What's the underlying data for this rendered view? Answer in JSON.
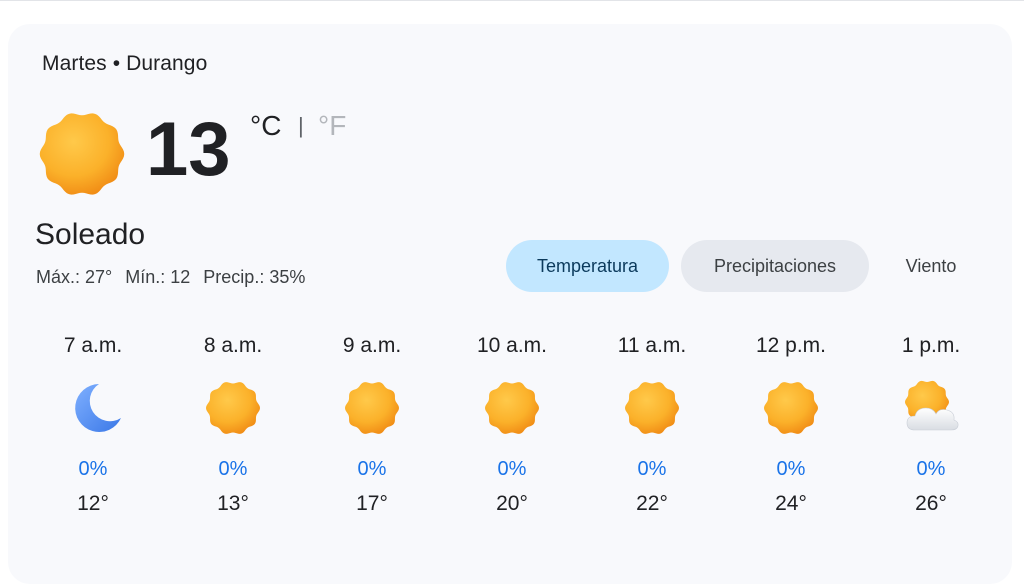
{
  "header": {
    "subtitle": "Martes • Durango"
  },
  "current": {
    "temperature": "13",
    "unit_c": "°C",
    "unit_separator": "|",
    "unit_f": "°F",
    "condition": "Soleado",
    "icon": "sun-icon",
    "max": "Máx.: 27°",
    "min": "Mín.: 12",
    "precip": "Precip.: 35%"
  },
  "tabs": [
    {
      "label": "Temperatura",
      "selected": true
    },
    {
      "label": "Precipitaciones",
      "selected": false
    },
    {
      "label": "Viento",
      "selected": false
    }
  ],
  "hourly": [
    {
      "time": "7 a.m.",
      "icon": "moon-icon",
      "precip": "0%",
      "temp": "12°"
    },
    {
      "time": "8 a.m.",
      "icon": "sun-icon",
      "precip": "0%",
      "temp": "13°"
    },
    {
      "time": "9 a.m.",
      "icon": "sun-icon",
      "precip": "0%",
      "temp": "17°"
    },
    {
      "time": "10 a.m.",
      "icon": "sun-icon",
      "precip": "0%",
      "temp": "20°"
    },
    {
      "time": "11 a.m.",
      "icon": "sun-icon",
      "precip": "0%",
      "temp": "22°"
    },
    {
      "time": "12 p.m.",
      "icon": "sun-icon",
      "precip": "0%",
      "temp": "24°"
    },
    {
      "time": "1 p.m.",
      "icon": "partly-cloudy-icon",
      "precip": "0%",
      "temp": "26°"
    }
  ],
  "colors": {
    "sun": "#fbb12a",
    "sun_edge": "#f29318",
    "moon": "#4a8af4",
    "precip_text": "#1a73e8",
    "selected_tab_bg": "#c2e7ff",
    "unselected_tab_bg": "#e6e9ef"
  }
}
